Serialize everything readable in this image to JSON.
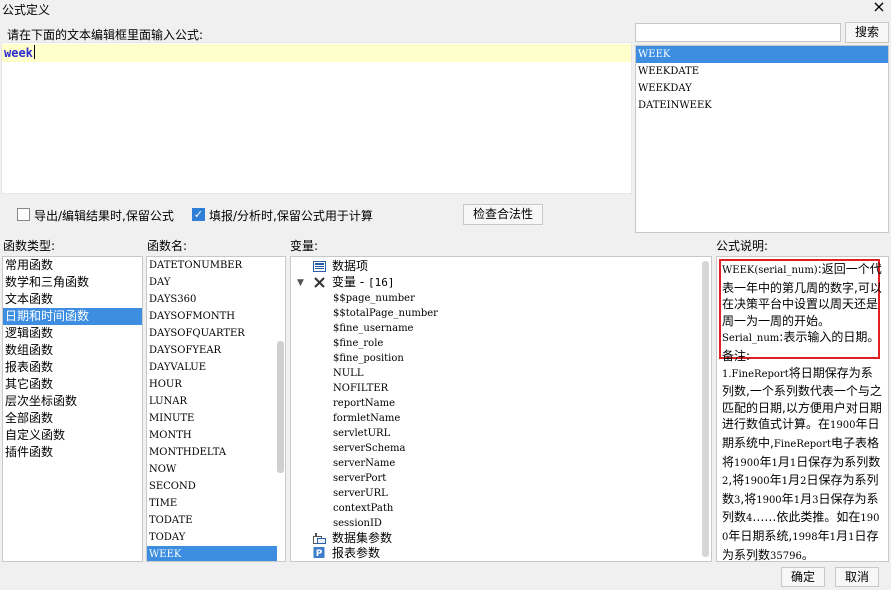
{
  "window": {
    "title": "公式定义",
    "close_icon": "×"
  },
  "editor": {
    "label": "请在下面的文本编辑框里面输入公式:",
    "content": "week"
  },
  "search": {
    "input_value": "",
    "button_label": "搜索"
  },
  "search_results": [
    "WEEK",
    "WEEKDATE",
    "WEEKDAY",
    "DATEINWEEK"
  ],
  "search_selected": "WEEK",
  "options": {
    "export_label": "导出/编辑结果时,保留公式",
    "export_checked": false,
    "fill_label": "填报/分析时,保留公式用于计算",
    "fill_checked": true,
    "check_button": "检查合法性"
  },
  "labels": {
    "categories": "函数类型:",
    "functions": "函数名:",
    "variables": "变量:",
    "description": "公式说明:"
  },
  "categories": [
    "常用函数",
    "数学和三角函数",
    "文本函数",
    "日期和时间函数",
    "逻辑函数",
    "数组函数",
    "报表函数",
    "其它函数",
    "层次坐标函数",
    "全部函数",
    "自定义函数",
    "插件函数"
  ],
  "category_selected": "日期和时间函数",
  "functions": [
    "DATETONUMBER",
    "DAY",
    "DAYS360",
    "DAYSOFMONTH",
    "DAYSOFQUARTER",
    "DAYSOFYEAR",
    "DAYVALUE",
    "HOUR",
    "LUNAR",
    "MINUTE",
    "MONTH",
    "MONTHDELTA",
    "NOW",
    "SECOND",
    "TIME",
    "TODATE",
    "TODAY",
    "WEEK"
  ],
  "function_selected": "WEEK",
  "variables": {
    "data_item": "数据项",
    "var_group": "变量",
    "var_count": "[16]",
    "items": [
      "$$page_number",
      "$$totalPage_number",
      "$fine_username",
      "$fine_role",
      "$fine_position",
      "NULL",
      "NOFILTER",
      "reportName",
      "formletName",
      "servletURL",
      "serverSchema",
      "serverName",
      "serverPort",
      "serverURL",
      "contextPath",
      "sessionID"
    ],
    "dataset_params": "数据集参数",
    "report_params": "报表参数"
  },
  "description": {
    "sig": "WEEK(serial_num)",
    "sig_rest": ":返回一个代表一年中的第几周的数字,可以在决策平台中设置以周天还是周一为一周的开始。",
    "param": "Serial_num",
    "param_rest": ":表示输入的日期。",
    "note_title": "备注:",
    "note_p1": "1.",
    "note_brand": "FineReport",
    "note_p2": "将日期保存为系列数,一个系列数代表一个与之匹配的日期,以方便用户对日期进行数值式计算。在",
    "y1900": "1900",
    "note_p3": "年日期系统中,",
    "note_brand2": "FineReport",
    "note_p4": "电子表格将",
    "d1": "1900",
    "d1b": "年",
    "d1c": "1",
    "d1d": "月",
    "d1e": "1",
    "d1f": "日保存为系列数",
    "d1g": "2",
    "d1h": ",将",
    "d2": "1900",
    "d2b": "年",
    "d2c": "1",
    "d2d": "月",
    "d2e": "2",
    "d2f": "日保存为系列数",
    "d2g": "3",
    "d2h": ",将",
    "d3": "1900",
    "d3b": "年",
    "d3c": "1",
    "d3d": "月",
    "d3e": "3",
    "d3f": "日保存为系列数",
    "d3g": "4",
    "d3h": "……依此类推。如在",
    "d4": "1900",
    "d4b": "年日期系统,",
    "d4c": "1998",
    "d4d": "年",
    "d4e": "1",
    "d4f": "月",
    "d4g": "1",
    "d4h": "日存为系列数",
    "d4i": "35796",
    "d4j": "。"
  },
  "buttons": {
    "ok": "确定",
    "cancel": "取消"
  }
}
